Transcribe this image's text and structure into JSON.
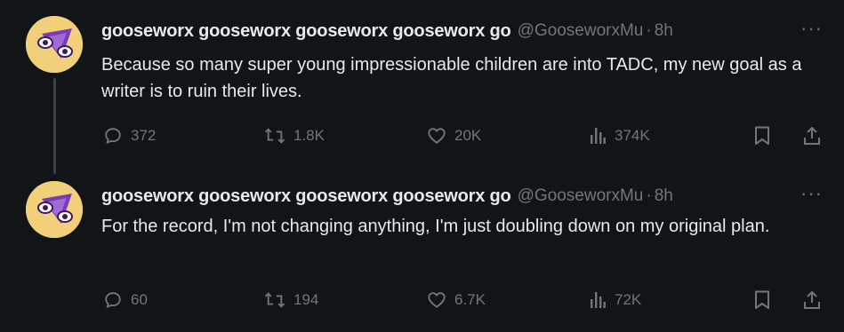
{
  "tweets": [
    {
      "display_name": "gooseworx gooseworx gooseworx gooseworx go",
      "handle": "@GooseworxMu",
      "separator": "·",
      "time": "8h",
      "more_label": "···",
      "text": "Because so many super young impressionable children are into TADC, my new goal as a writer is to ruin their lives.",
      "actions": {
        "replies": "372",
        "reposts": "1.8K",
        "likes": "20K",
        "views": "374K"
      }
    },
    {
      "display_name": "gooseworx gooseworx gooseworx gooseworx go",
      "handle": "@GooseworxMu",
      "separator": "·",
      "time": "8h",
      "more_label": "···",
      "text": "For the record, I'm not changing anything, I'm just doubling down on my original plan.",
      "actions": {
        "replies": "60",
        "reposts": "194",
        "likes": "6.7K",
        "views": "72K"
      }
    }
  ],
  "colors": {
    "background": "#111518",
    "text": "#e7e9ea",
    "muted": "#71767b",
    "avatar_bg": "#f2d07a",
    "avatar_accent": "#7b3bb8"
  },
  "icons": [
    "avatar",
    "reply-icon",
    "retweet-icon",
    "like-icon",
    "views-icon",
    "bookmark-icon",
    "share-icon",
    "more-icon"
  ]
}
